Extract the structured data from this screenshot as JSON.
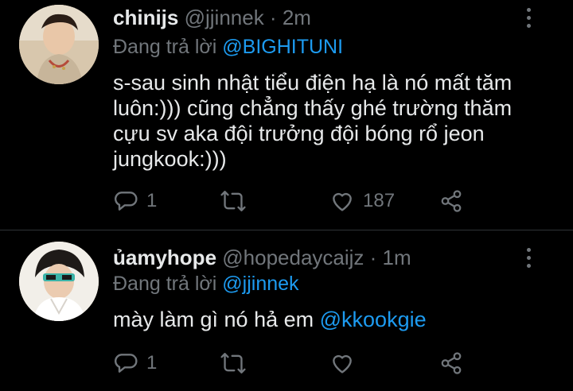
{
  "tweets": [
    {
      "display_name": "chinijs",
      "handle": "@jjinnek",
      "separator": " · ",
      "time": "2m",
      "replying_prefix": "Đang trả lời ",
      "replying_to": "@BIGHITUNI",
      "text_lines": [
        "s-sau sinh nhật tiểu điện hạ là nó mất tăm",
        "luôn:))) cũng chẳng thấy ghé trường thăm",
        "cựu sv aka đội trưởng đội bóng rổ jeon",
        "jungkook:)))"
      ],
      "reply_count": "1",
      "retweet_count": "",
      "like_count": "187"
    },
    {
      "display_name": "ủamyhope",
      "handle": "@hopedaycaijz",
      "separator": " · ",
      "time": "1m",
      "replying_prefix": "Đang trả lời ",
      "replying_to": "@jjinnek",
      "text_prefix": "mày làm gì nó hả em ",
      "text_mention": "@kkookgie",
      "reply_count": "1",
      "retweet_count": "",
      "like_count": ""
    }
  ],
  "colors": {
    "background": "#000000",
    "text": "#e7e9ea",
    "muted": "#71767b",
    "accent": "#1d9bf0"
  },
  "icons": [
    "avatar",
    "more-icon",
    "reply-icon",
    "retweet-icon",
    "like-icon",
    "share-icon"
  ]
}
